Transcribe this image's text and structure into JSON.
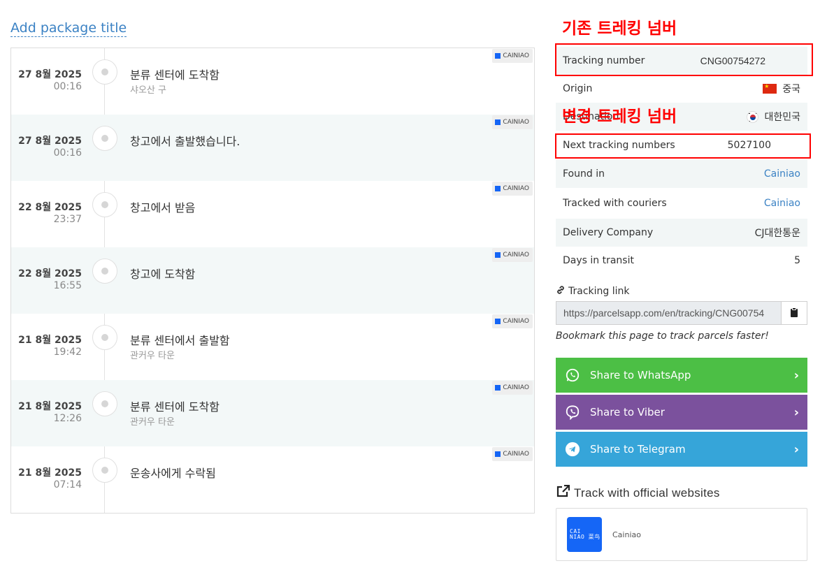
{
  "package": {
    "add_title_link": "Add package title"
  },
  "carrier_badge": "CAINIAO",
  "events": [
    {
      "date": "27 8월 2025",
      "time": "00:16",
      "status": "분류 센터에 도착함",
      "location": "샤오산 구"
    },
    {
      "date": "27 8월 2025",
      "time": "00:16",
      "status": "창고에서 출발했습니다.",
      "location": ""
    },
    {
      "date": "22 8월 2025",
      "time": "23:37",
      "status": "창고에서 받음",
      "location": ""
    },
    {
      "date": "22 8월 2025",
      "time": "16:55",
      "status": "창고에 도착함",
      "location": ""
    },
    {
      "date": "21 8월 2025",
      "time": "19:42",
      "status": "분류 센터에서 출발함",
      "location": "관커우 타운"
    },
    {
      "date": "21 8월 2025",
      "time": "12:26",
      "status": "분류 센터에 도착함",
      "location": "관커우 타운"
    },
    {
      "date": "21 8월 2025",
      "time": "07:14",
      "status": "운송사에게 수락됨",
      "location": ""
    }
  ],
  "info": {
    "tracking_number_label": "Tracking number",
    "tracking_number_value": "CNG00754272",
    "origin_label": "Origin",
    "origin_value": "중국",
    "destination_label": "Destination",
    "destination_value": "대한민국",
    "next_label": "Next tracking numbers",
    "next_value": "5027100",
    "found_in_label": "Found in",
    "found_in_value": "Cainiao",
    "tracked_with_label": "Tracked with couriers",
    "tracked_with_value": "Cainiao",
    "delivery_company_label": "Delivery Company",
    "delivery_company_value": "CJ대한통운",
    "days_label": "Days in transit",
    "days_value": "5"
  },
  "annotations": {
    "existing_label": "기존 트레킹 넘버",
    "changed_label": "변경 트레킹 넘버",
    "color": "#ff0000"
  },
  "tracking_link": {
    "label": "Tracking link",
    "url": "https://parcelsapp.com/en/tracking/CNG00754",
    "note": "Bookmark this page to track parcels faster!"
  },
  "share": {
    "whatsapp": "Share to WhatsApp",
    "viber": "Share to Viber",
    "telegram": "Share to Telegram",
    "colors": {
      "whatsapp": "#4cbf45",
      "viber": "#7b519d",
      "telegram": "#36a5d9"
    }
  },
  "official": {
    "title": "Track with official websites",
    "site_name": "Cainiao",
    "logo_text": [
      "CAI",
      "NIAO 菜鸟"
    ]
  }
}
